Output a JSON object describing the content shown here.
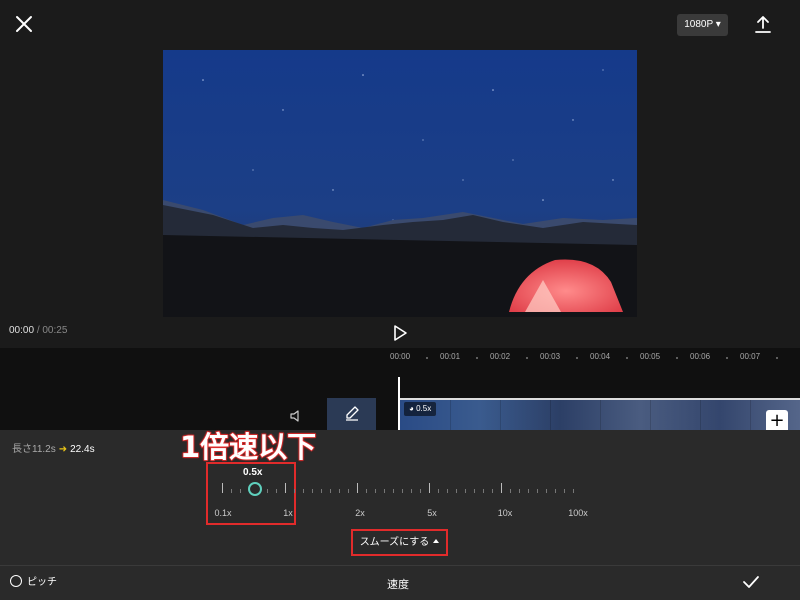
{
  "top_bar": {
    "close_icon": "close-icon",
    "resolution_label": "1080P",
    "export_icon": "export-icon"
  },
  "player": {
    "current_time": "00:00",
    "separator": "/",
    "total_time": "00:25",
    "play_icon": "play-icon"
  },
  "timeline": {
    "ruler_labels": [
      "00:00",
      "00:01",
      "00:02",
      "00:03",
      "00:04",
      "00:05",
      "00:06",
      "00:07"
    ],
    "clip_speed_badge": "0.5x",
    "add_clip_label": "+"
  },
  "speed_panel": {
    "duration_label": "長さ11.2s",
    "duration_new": "22.4s",
    "annotation_text": "1倍速以下",
    "current_speed": "0.5x",
    "speed_labels": [
      "0.1x",
      "1x",
      "2x",
      "5x",
      "10x",
      "100x"
    ],
    "slider_value": 0.5,
    "smooth_button_label": "スムーズにする"
  },
  "bottom_bar": {
    "pitch_label": "ピッチ",
    "title": "速度",
    "confirm_icon": "check-icon"
  },
  "colors": {
    "accent_knob": "#5fd0bd",
    "annotation_red": "#e12b2b",
    "arrow_yellow": "#e7c318"
  }
}
